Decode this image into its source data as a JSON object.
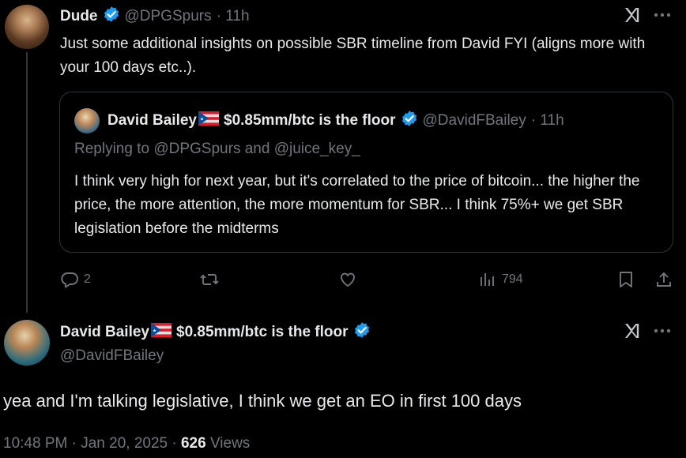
{
  "tweet1": {
    "name": "Dude",
    "handle": "@DPGSpurs",
    "time": "· 11h",
    "text": "Just some additional insights on possible SBR timeline from David FYI (aligns more with your 100 days etc..).",
    "quote": {
      "name": "David Bailey",
      "name_suffix": "$0.85mm/btc is the floor",
      "handle": "@DavidFBailey",
      "time": "· 11h",
      "replying_prefix": "Replying to",
      "replying_user1": "@DPGSpurs",
      "replying_and": "and",
      "replying_user2": "@juice_key_",
      "text": "I think very high for next year, but it's correlated to the price of bitcoin... the higher the price, the more attention, the more momentum for SBR... I think 75%+ we get SBR legislation before the midterms"
    },
    "actions": {
      "replies": "2",
      "views": "794"
    }
  },
  "tweet2": {
    "name": "David Bailey",
    "name_suffix": "$0.85mm/btc is the floor",
    "handle": "@DavidFBailey",
    "text": "yea and I'm talking legislative, I think we get an EO in first 100 days",
    "timestamp": "10:48 PM · Jan 20, 2025 ·",
    "views_count": "626",
    "views_label": "Views"
  },
  "icons": {
    "verified": "verified-badge-icon",
    "grok": "grok-icon",
    "more": "more-icon",
    "flag": "puerto-rico-flag-icon"
  },
  "colors": {
    "background": "#000000",
    "text": "#e7e9ea",
    "muted": "#71767b",
    "border": "#2f3336",
    "verified": "#1d9bf0"
  }
}
